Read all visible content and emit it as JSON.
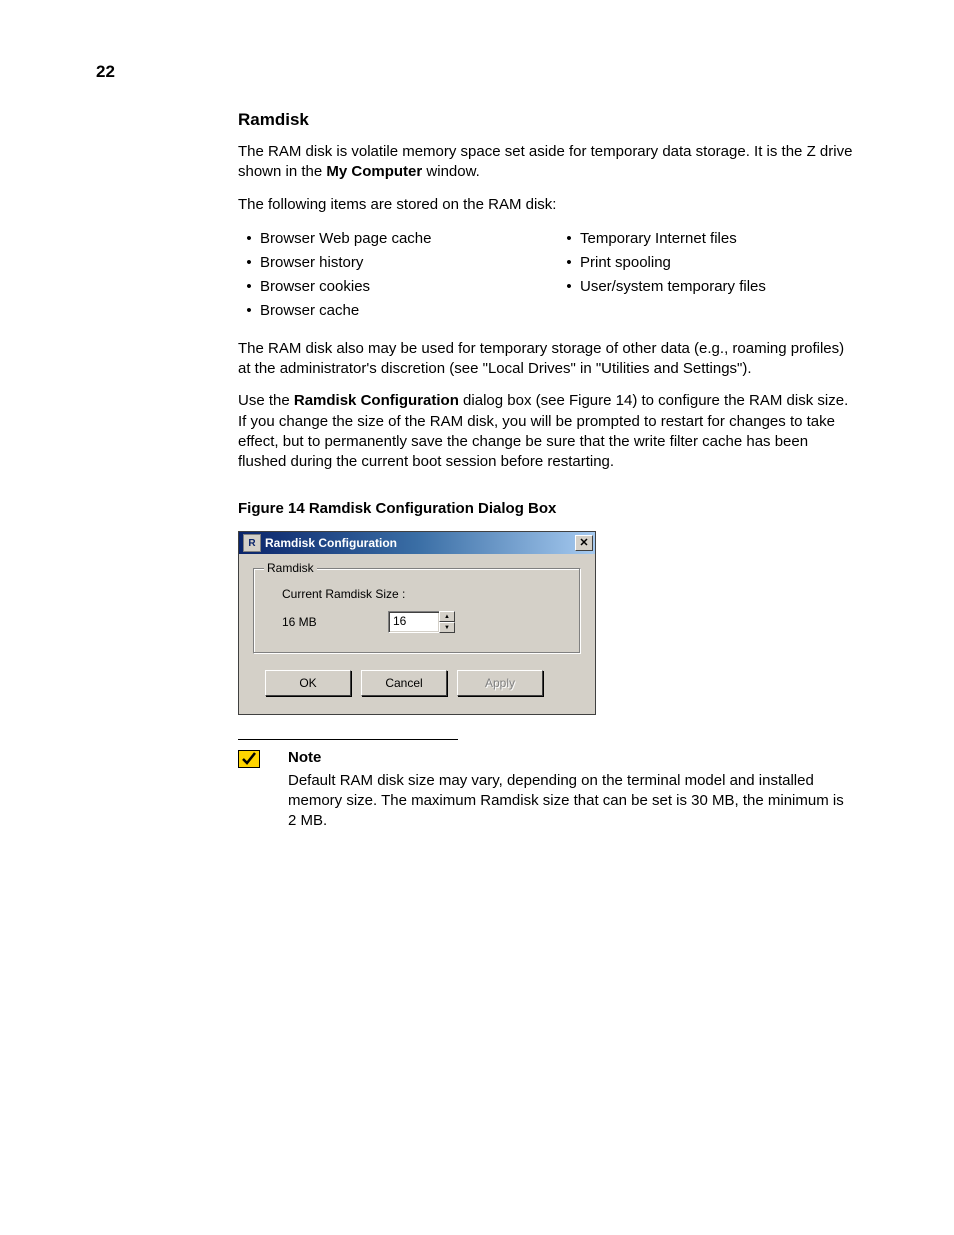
{
  "page_number": "22",
  "section_title": "Ramdisk",
  "para1_pre": "The RAM disk is volatile memory space set aside for temporary data storage. It is the Z drive shown in the ",
  "para1_bold": "My Computer",
  "para1_post": " window.",
  "para2": "The following items are stored on the RAM disk:",
  "bullets_left": [
    "Browser Web page cache",
    "Browser history",
    "Browser cookies",
    "Browser cache"
  ],
  "bullets_right": [
    "Temporary Internet files",
    "Print spooling",
    "User/system temporary files"
  ],
  "para3": "The RAM disk also may be used for temporary storage of other data (e.g., roaming profiles) at the administrator's discretion (see \"Local Drives\" in \"Utilities and Settings\").",
  "para4_pre": "Use the ",
  "para4_bold": "Ramdisk Configuration",
  "para4_post": " dialog box (see Figure 14) to configure the RAM disk size. If you change the size of the RAM disk, you will be prompted to restart for changes to take effect, but to permanently save the change be sure that the write filter cache has been flushed during the current boot session before restarting.",
  "figure_caption": "Figure 14    Ramdisk Configuration Dialog Box",
  "dialog": {
    "title": "Ramdisk Configuration",
    "group_legend": "Ramdisk",
    "size_label": "Current Ramdisk Size :",
    "size_display": "16    MB",
    "size_value": "16",
    "ok": "OK",
    "cancel": "Cancel",
    "apply": "Apply"
  },
  "note": {
    "label": "Note",
    "text": "Default RAM disk size may vary, depending on the terminal model and installed memory size. The maximum Ramdisk size that can be set is 30 MB, the minimum is 2 MB."
  }
}
